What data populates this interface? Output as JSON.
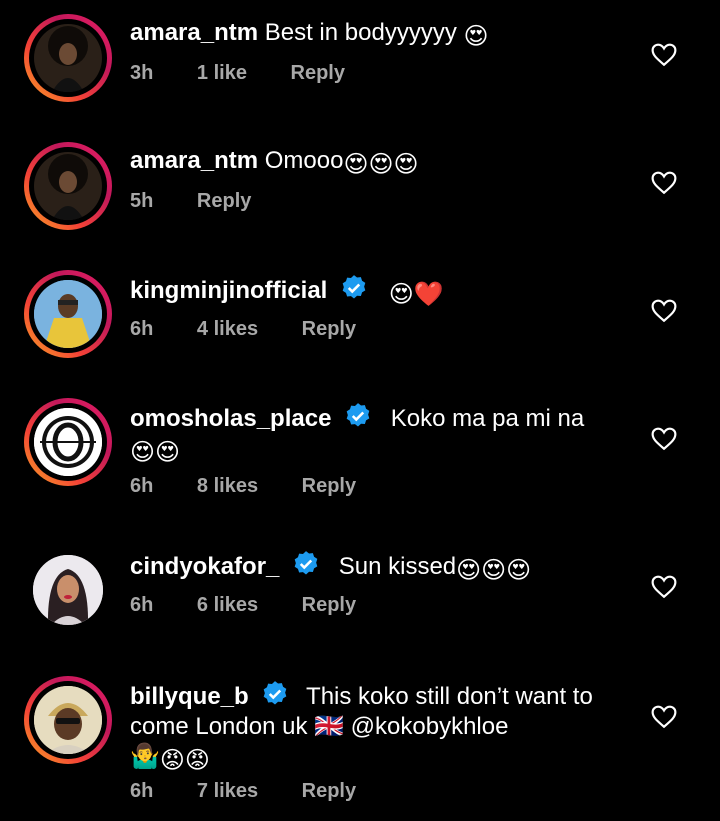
{
  "comments": [
    {
      "username": "amara_ntm",
      "verified": false,
      "text": "Best in bodyyyyyy",
      "emoji": "😍",
      "time": "3h",
      "likes": "1 like",
      "reply": "Reply",
      "avatar": "afro-woman-avatar"
    },
    {
      "username": "amara_ntm",
      "verified": false,
      "text": "Omooo",
      "emoji": "😍😍😍",
      "time": "5h",
      "likes": "",
      "reply": "Reply",
      "avatar": "afro-woman-avatar"
    },
    {
      "username": "kingminjinofficial",
      "verified": true,
      "text": "",
      "emoji": "😍❤️",
      "time": "6h",
      "likes": "4 likes",
      "reply": "Reply",
      "avatar": "yellow-outfit-avatar"
    },
    {
      "username": "omosholas_place",
      "verified": true,
      "text": "Koko ma pa mi na",
      "emoji": "😍😍",
      "time": "6h",
      "likes": "8 likes",
      "reply": "Reply",
      "avatar": "o-logo-avatar"
    },
    {
      "username": "cindyokafor_",
      "verified": true,
      "text": "Sun kissed",
      "emoji": "😍😍😍",
      "time": "6h",
      "likes": "6 likes",
      "reply": "Reply",
      "avatar": "woman-portrait-avatar"
    },
    {
      "username": "billyque_b",
      "verified": true,
      "text": "This koko still don’t want to come London uk 🇬🇧 @kokobykhloe",
      "text2": "🤷‍♂️",
      "emoji": "😡😡",
      "time": "6h",
      "likes": "7 likes",
      "reply": "Reply",
      "avatar": "man-cap-avatar"
    }
  ],
  "colors": {
    "background": "#000000",
    "meta": "#a8a8a8",
    "verified": "#1d9bf0"
  }
}
